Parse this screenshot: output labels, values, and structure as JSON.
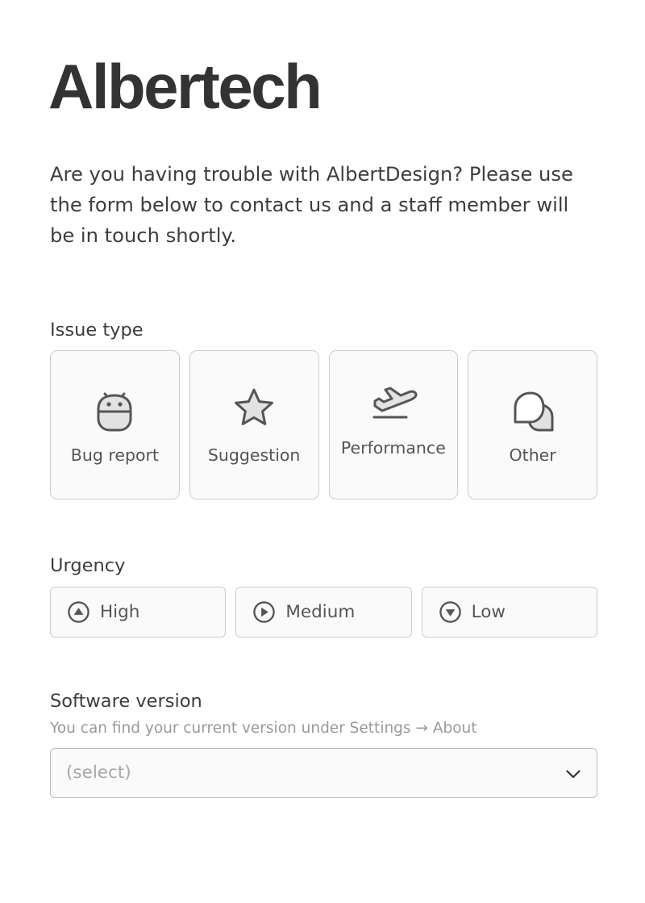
{
  "header": {
    "brand": "Albertech",
    "intro": "Are you having trouble with AlbertDesign? Please use the form below to contact us and a staff member will be in touch shortly."
  },
  "issue_type": {
    "label": "Issue type",
    "options": [
      {
        "label": "Bug report",
        "icon": "bug-icon"
      },
      {
        "label": "Suggestion",
        "icon": "star-icon"
      },
      {
        "label": "Performance",
        "icon": "airplane-takeoff-icon"
      },
      {
        "label": "Other",
        "icon": "chat-bubbles-icon"
      }
    ]
  },
  "urgency": {
    "label": "Urgency",
    "options": [
      {
        "label": "High",
        "icon": "circle-arrow-up-icon"
      },
      {
        "label": "Medium",
        "icon": "circle-arrow-right-icon"
      },
      {
        "label": "Low",
        "icon": "circle-arrow-down-icon"
      }
    ]
  },
  "software_version": {
    "label": "Software version",
    "hint": "You can find your current version under Settings → About",
    "selected": "(select)",
    "icon": "chevron-down-icon"
  },
  "colors": {
    "text": "#3d3d3d",
    "muted": "#9a9a9a",
    "border": "#cdcdcd",
    "icon_stroke": "#555555",
    "icon_fill": "#e2e2e2",
    "card_bg": "#fafafa"
  }
}
